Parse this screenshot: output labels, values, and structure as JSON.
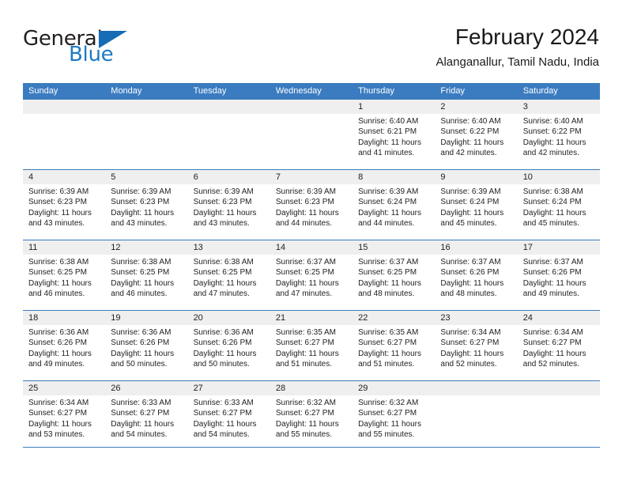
{
  "brand": {
    "logo_word_1": "General",
    "logo_word_2": "Blue",
    "triangle_icon": "triangle-icon",
    "accent_color": "#1f7ac4",
    "header_color": "#3b7cc0"
  },
  "header": {
    "title": "February 2024",
    "subtitle": "Alanganallur, Tamil Nadu, India"
  },
  "calendar": {
    "weekday_headers": [
      "Sunday",
      "Monday",
      "Tuesday",
      "Wednesday",
      "Thursday",
      "Friday",
      "Saturday"
    ],
    "weeks": [
      [
        {
          "day": "",
          "sunrise": "",
          "sunset": "",
          "daylight_line1": "",
          "daylight_line2": ""
        },
        {
          "day": "",
          "sunrise": "",
          "sunset": "",
          "daylight_line1": "",
          "daylight_line2": ""
        },
        {
          "day": "",
          "sunrise": "",
          "sunset": "",
          "daylight_line1": "",
          "daylight_line2": ""
        },
        {
          "day": "",
          "sunrise": "",
          "sunset": "",
          "daylight_line1": "",
          "daylight_line2": ""
        },
        {
          "day": "1",
          "sunrise": "Sunrise: 6:40 AM",
          "sunset": "Sunset: 6:21 PM",
          "daylight_line1": "Daylight: 11 hours",
          "daylight_line2": "and 41 minutes."
        },
        {
          "day": "2",
          "sunrise": "Sunrise: 6:40 AM",
          "sunset": "Sunset: 6:22 PM",
          "daylight_line1": "Daylight: 11 hours",
          "daylight_line2": "and 42 minutes."
        },
        {
          "day": "3",
          "sunrise": "Sunrise: 6:40 AM",
          "sunset": "Sunset: 6:22 PM",
          "daylight_line1": "Daylight: 11 hours",
          "daylight_line2": "and 42 minutes."
        }
      ],
      [
        {
          "day": "4",
          "sunrise": "Sunrise: 6:39 AM",
          "sunset": "Sunset: 6:23 PM",
          "daylight_line1": "Daylight: 11 hours",
          "daylight_line2": "and 43 minutes."
        },
        {
          "day": "5",
          "sunrise": "Sunrise: 6:39 AM",
          "sunset": "Sunset: 6:23 PM",
          "daylight_line1": "Daylight: 11 hours",
          "daylight_line2": "and 43 minutes."
        },
        {
          "day": "6",
          "sunrise": "Sunrise: 6:39 AM",
          "sunset": "Sunset: 6:23 PM",
          "daylight_line1": "Daylight: 11 hours",
          "daylight_line2": "and 43 minutes."
        },
        {
          "day": "7",
          "sunrise": "Sunrise: 6:39 AM",
          "sunset": "Sunset: 6:23 PM",
          "daylight_line1": "Daylight: 11 hours",
          "daylight_line2": "and 44 minutes."
        },
        {
          "day": "8",
          "sunrise": "Sunrise: 6:39 AM",
          "sunset": "Sunset: 6:24 PM",
          "daylight_line1": "Daylight: 11 hours",
          "daylight_line2": "and 44 minutes."
        },
        {
          "day": "9",
          "sunrise": "Sunrise: 6:39 AM",
          "sunset": "Sunset: 6:24 PM",
          "daylight_line1": "Daylight: 11 hours",
          "daylight_line2": "and 45 minutes."
        },
        {
          "day": "10",
          "sunrise": "Sunrise: 6:38 AM",
          "sunset": "Sunset: 6:24 PM",
          "daylight_line1": "Daylight: 11 hours",
          "daylight_line2": "and 45 minutes."
        }
      ],
      [
        {
          "day": "11",
          "sunrise": "Sunrise: 6:38 AM",
          "sunset": "Sunset: 6:25 PM",
          "daylight_line1": "Daylight: 11 hours",
          "daylight_line2": "and 46 minutes."
        },
        {
          "day": "12",
          "sunrise": "Sunrise: 6:38 AM",
          "sunset": "Sunset: 6:25 PM",
          "daylight_line1": "Daylight: 11 hours",
          "daylight_line2": "and 46 minutes."
        },
        {
          "day": "13",
          "sunrise": "Sunrise: 6:38 AM",
          "sunset": "Sunset: 6:25 PM",
          "daylight_line1": "Daylight: 11 hours",
          "daylight_line2": "and 47 minutes."
        },
        {
          "day": "14",
          "sunrise": "Sunrise: 6:37 AM",
          "sunset": "Sunset: 6:25 PM",
          "daylight_line1": "Daylight: 11 hours",
          "daylight_line2": "and 47 minutes."
        },
        {
          "day": "15",
          "sunrise": "Sunrise: 6:37 AM",
          "sunset": "Sunset: 6:25 PM",
          "daylight_line1": "Daylight: 11 hours",
          "daylight_line2": "and 48 minutes."
        },
        {
          "day": "16",
          "sunrise": "Sunrise: 6:37 AM",
          "sunset": "Sunset: 6:26 PM",
          "daylight_line1": "Daylight: 11 hours",
          "daylight_line2": "and 48 minutes."
        },
        {
          "day": "17",
          "sunrise": "Sunrise: 6:37 AM",
          "sunset": "Sunset: 6:26 PM",
          "daylight_line1": "Daylight: 11 hours",
          "daylight_line2": "and 49 minutes."
        }
      ],
      [
        {
          "day": "18",
          "sunrise": "Sunrise: 6:36 AM",
          "sunset": "Sunset: 6:26 PM",
          "daylight_line1": "Daylight: 11 hours",
          "daylight_line2": "and 49 minutes."
        },
        {
          "day": "19",
          "sunrise": "Sunrise: 6:36 AM",
          "sunset": "Sunset: 6:26 PM",
          "daylight_line1": "Daylight: 11 hours",
          "daylight_line2": "and 50 minutes."
        },
        {
          "day": "20",
          "sunrise": "Sunrise: 6:36 AM",
          "sunset": "Sunset: 6:26 PM",
          "daylight_line1": "Daylight: 11 hours",
          "daylight_line2": "and 50 minutes."
        },
        {
          "day": "21",
          "sunrise": "Sunrise: 6:35 AM",
          "sunset": "Sunset: 6:27 PM",
          "daylight_line1": "Daylight: 11 hours",
          "daylight_line2": "and 51 minutes."
        },
        {
          "day": "22",
          "sunrise": "Sunrise: 6:35 AM",
          "sunset": "Sunset: 6:27 PM",
          "daylight_line1": "Daylight: 11 hours",
          "daylight_line2": "and 51 minutes."
        },
        {
          "day": "23",
          "sunrise": "Sunrise: 6:34 AM",
          "sunset": "Sunset: 6:27 PM",
          "daylight_line1": "Daylight: 11 hours",
          "daylight_line2": "and 52 minutes."
        },
        {
          "day": "24",
          "sunrise": "Sunrise: 6:34 AM",
          "sunset": "Sunset: 6:27 PM",
          "daylight_line1": "Daylight: 11 hours",
          "daylight_line2": "and 52 minutes."
        }
      ],
      [
        {
          "day": "25",
          "sunrise": "Sunrise: 6:34 AM",
          "sunset": "Sunset: 6:27 PM",
          "daylight_line1": "Daylight: 11 hours",
          "daylight_line2": "and 53 minutes."
        },
        {
          "day": "26",
          "sunrise": "Sunrise: 6:33 AM",
          "sunset": "Sunset: 6:27 PM",
          "daylight_line1": "Daylight: 11 hours",
          "daylight_line2": "and 54 minutes."
        },
        {
          "day": "27",
          "sunrise": "Sunrise: 6:33 AM",
          "sunset": "Sunset: 6:27 PM",
          "daylight_line1": "Daylight: 11 hours",
          "daylight_line2": "and 54 minutes."
        },
        {
          "day": "28",
          "sunrise": "Sunrise: 6:32 AM",
          "sunset": "Sunset: 6:27 PM",
          "daylight_line1": "Daylight: 11 hours",
          "daylight_line2": "and 55 minutes."
        },
        {
          "day": "29",
          "sunrise": "Sunrise: 6:32 AM",
          "sunset": "Sunset: 6:27 PM",
          "daylight_line1": "Daylight: 11 hours",
          "daylight_line2": "and 55 minutes."
        },
        {
          "day": "",
          "sunrise": "",
          "sunset": "",
          "daylight_line1": "",
          "daylight_line2": ""
        },
        {
          "day": "",
          "sunrise": "",
          "sunset": "",
          "daylight_line1": "",
          "daylight_line2": ""
        }
      ]
    ]
  }
}
